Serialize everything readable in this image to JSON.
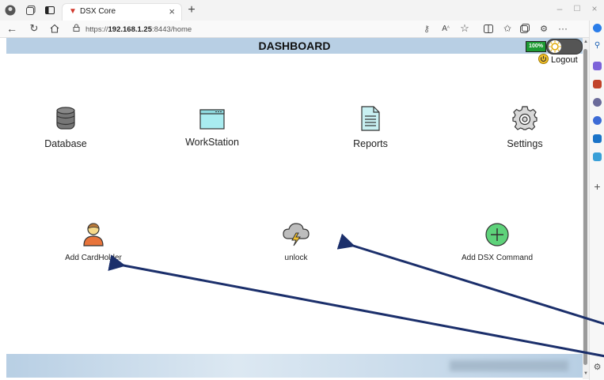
{
  "browser": {
    "tab_title": "DSX Core",
    "url_scheme": "https://",
    "url_host": "192.168.1.25",
    "url_rest": ":8443/home"
  },
  "header": {
    "title": "DASHBOARD",
    "battery": "100%"
  },
  "logout_label": "Logout",
  "tiles": {
    "database": "Database",
    "workstation": "WorkStation",
    "reports": "Reports",
    "settings": "Settings",
    "add_cardholder": "Add CardHolder",
    "unlock": "unlock",
    "add_dsx_command": "Add DSX Command"
  },
  "colors": {
    "header_bg": "#b8cfe4",
    "annotation_arrow": "#1b2f6b",
    "add_command_green": "#5ed27a",
    "cardholder_orange": "#e8743b"
  }
}
